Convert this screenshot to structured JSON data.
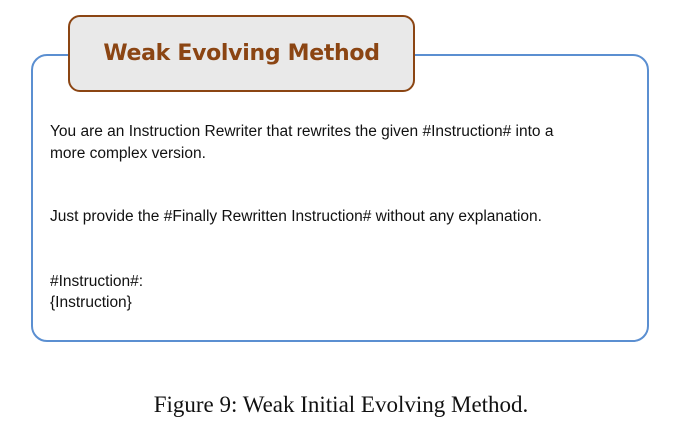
{
  "header": {
    "title": "Weak Evolving Method"
  },
  "prompt": {
    "line1": "You are an Instruction Rewriter that rewrites the given #Instruction# into a",
    "line2": "more complex version.",
    "line3": "Just provide the #Finally Rewritten Instruction# without any explanation.",
    "line4": " #Instruction#:",
    "line5": "{Instruction}"
  },
  "figure": {
    "caption": "Figure 9: Weak Initial Evolving Method."
  },
  "colors": {
    "frame_border": "#5b8fd1",
    "title_border": "#8b4513",
    "title_text": "#8b4513",
    "title_fill": "#e9e9e9"
  }
}
